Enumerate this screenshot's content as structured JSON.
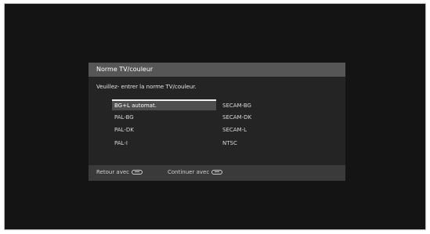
{
  "dialog": {
    "title": "Norme TV/couleur",
    "prompt": "Veuillez- entrer la norme TV/couleur."
  },
  "options": {
    "left": [
      "BG+L automat.",
      "PAL-BG",
      "PAL-DK",
      "PAL-I"
    ],
    "right": [
      "SECAM-BG",
      "SECAM-DK",
      "SECAM-L",
      "NTSC"
    ],
    "selected": "BG+L automat."
  },
  "footer": {
    "back_label": "Retour avec",
    "back_icon": "remote-button-icon",
    "continue_label": "Continuer avec",
    "continue_icon": "remote-button-icon"
  },
  "colors": {
    "screen_bg": "#141414",
    "dialog_title_bg": "#565656",
    "dialog_body_bg": "#242424",
    "selection_bg": "#4e4e4e"
  }
}
